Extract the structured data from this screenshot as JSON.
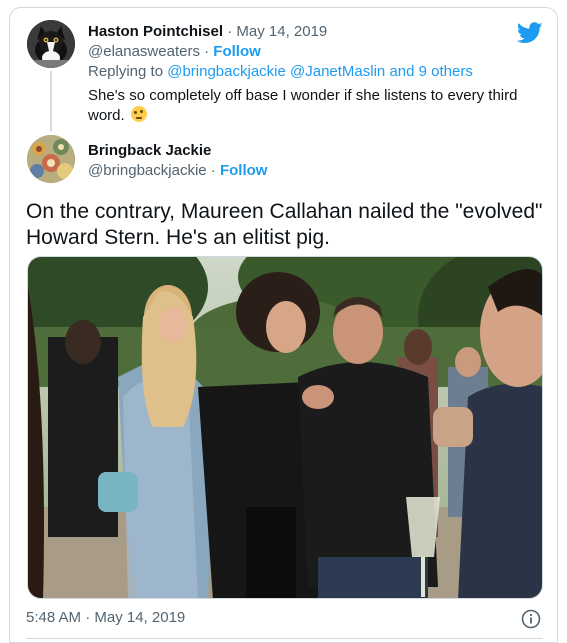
{
  "reply_tweet": {
    "name": "Haston Pointchisel",
    "date": "May 14, 2019",
    "handle": "@elanasweaters",
    "follow_label": "Follow",
    "replying_prefix": "Replying to",
    "replying_users": "@bringbackjackie @JanetMaslin",
    "replying_suffix": "and 9 others",
    "text": "She's so completely off base I wonder if she listens to every third word.",
    "emoji_icon": "face-with-rolling-eyes-icon",
    "avatar_icon": "cat-avatar-icon"
  },
  "main_tweet": {
    "name": "Bringback Jackie",
    "handle": "@bringbackjackie",
    "follow_label": "Follow",
    "text": "On the contrary, Maureen Callahan nailed the \"evolved\" Howard Stern.  He's an elitist pig.",
    "avatar_icon": "pattern-avatar-icon",
    "photo_icon": "party-photo-image",
    "timestamp": "5:48 AM · May 14, 2019"
  },
  "icons": {
    "brand": "twitter-bird-icon",
    "info": "info-circle-icon"
  },
  "colors": {
    "accent": "#1d9bf0",
    "text": "#0f1419",
    "muted": "#536471",
    "border": "#cfd9de"
  }
}
